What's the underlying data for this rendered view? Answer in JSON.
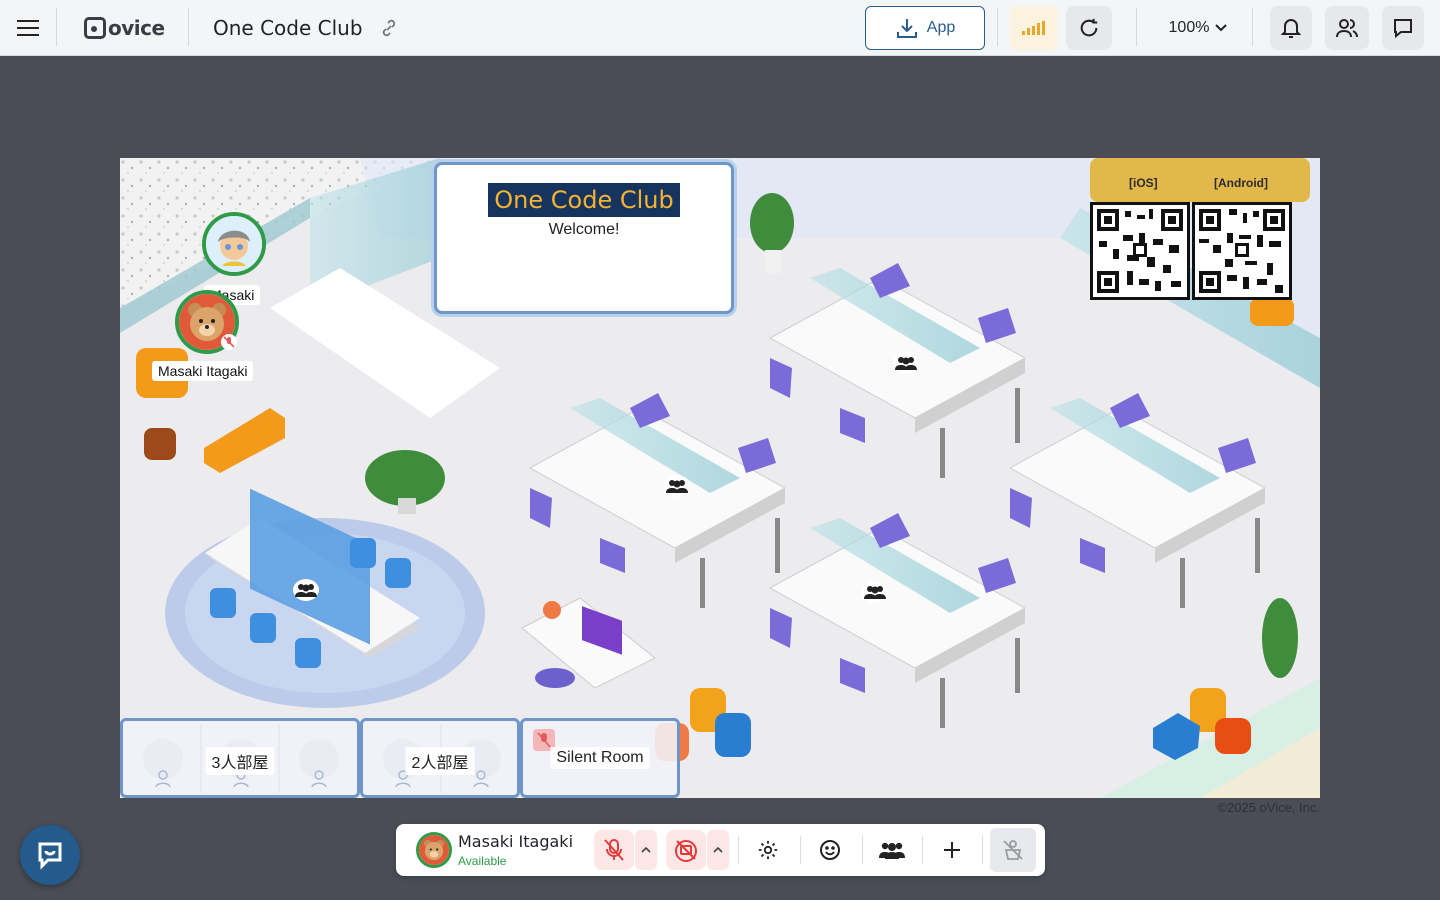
{
  "topbar": {
    "brand": "ovice",
    "room_title": "One Code Club",
    "app_label": "App",
    "zoom_level": "100%"
  },
  "map": {
    "board_title": "One Code Club",
    "board_subtitle": "Welcome!",
    "qr_ios_label": "[iOS]",
    "qr_android_label": "[Android]",
    "users": [
      {
        "name": "Masaki"
      },
      {
        "name": "Masaki Itagaki"
      }
    ],
    "rooms": [
      {
        "label": "3人部屋"
      },
      {
        "label": "2人部屋"
      },
      {
        "label": "Silent Room"
      }
    ],
    "copyright": "©2025 oVice, Inc."
  },
  "bottombar": {
    "user_name": "Masaki Itagaki",
    "user_status": "Available"
  },
  "colors": {
    "accent": "#2a5d8f",
    "available_green": "#2f9a48",
    "board_navy": "#16345e",
    "board_gold": "#f3b333",
    "chair_purple": "#7b6bd8"
  }
}
